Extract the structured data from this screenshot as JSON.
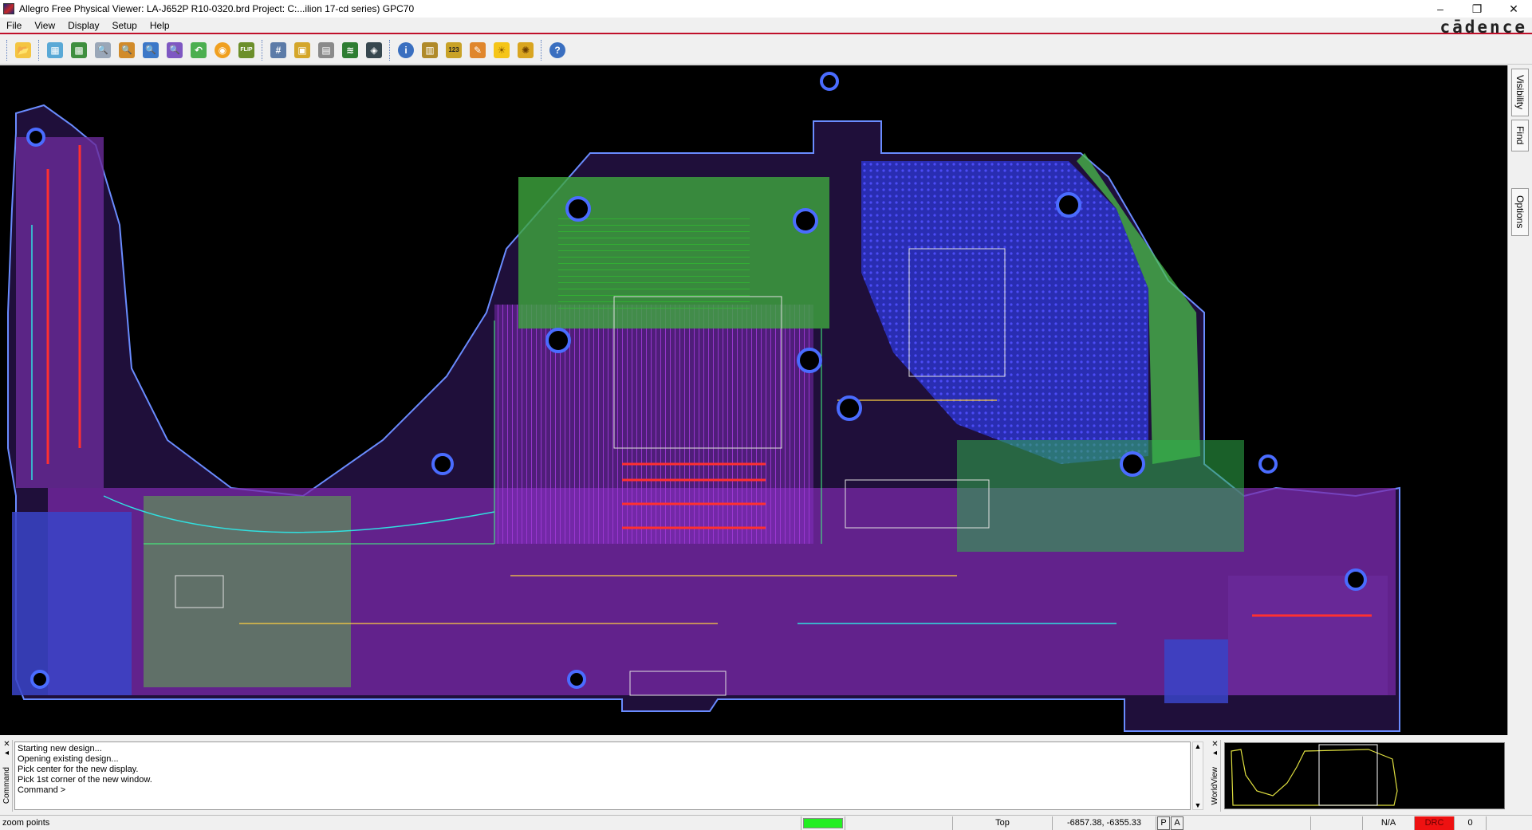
{
  "window": {
    "title": "Allegro Free Physical Viewer: LA-J652P R10-0320.brd  Project: C:...ilion 17-cd series) GPC70",
    "minimize": "–",
    "restore": "❐",
    "close": "✕",
    "brand": "cādence"
  },
  "menu": {
    "items": [
      {
        "label": "File"
      },
      {
        "label": "View"
      },
      {
        "label": "Display"
      },
      {
        "label": "Setup"
      },
      {
        "label": "Help"
      }
    ]
  },
  "toolbar": {
    "buttons": [
      {
        "icon": "open-folder-icon",
        "glyph": "📂"
      },
      {
        "icon": "zoom-fit-icon",
        "glyph": "▦"
      },
      {
        "icon": "zoom-world-icon",
        "glyph": "▩"
      },
      {
        "icon": "zoom-points-icon",
        "glyph": "🔍"
      },
      {
        "icon": "zoom-window-icon",
        "glyph": "🔍"
      },
      {
        "icon": "zoom-in-icon",
        "glyph": "🔍"
      },
      {
        "icon": "zoom-out-icon",
        "glyph": "🔍"
      },
      {
        "icon": "zoom-previous-icon",
        "glyph": "↶"
      },
      {
        "icon": "redraw-icon",
        "glyph": "◉"
      },
      {
        "icon": "flip-icon",
        "glyph": "FLIP"
      },
      {
        "icon": "grid-icon",
        "glyph": "#"
      },
      {
        "icon": "color-icon",
        "glyph": "▣"
      },
      {
        "icon": "layers-icon",
        "glyph": "▤"
      },
      {
        "icon": "stack-icon",
        "glyph": "≋"
      },
      {
        "icon": "3d-view-icon",
        "glyph": "◈"
      },
      {
        "icon": "info-icon",
        "glyph": "i"
      },
      {
        "icon": "report-icon",
        "glyph": "▥"
      },
      {
        "icon": "measure-icon",
        "glyph": "123"
      },
      {
        "icon": "highlight-icon",
        "glyph": "✎"
      },
      {
        "icon": "shadow-icon",
        "glyph": "☀"
      },
      {
        "icon": "dehighlight-icon",
        "glyph": "✺"
      },
      {
        "icon": "help-icon",
        "glyph": "?"
      }
    ]
  },
  "side_tabs": {
    "visibility": "Visibility",
    "find": "Find",
    "options": "Options"
  },
  "command": {
    "panel_label": "Command",
    "lines": [
      "Starting new design...",
      "Opening existing design...",
      "Pick center for the new display.",
      "Pick 1st corner of the new window.",
      "Command >"
    ]
  },
  "worldview": {
    "panel_label": "WorldView"
  },
  "status": {
    "message": "zoom points",
    "layer": "Top",
    "coords": "-6857.38, -6355.33",
    "p_flag": "P",
    "a_flag": "A",
    "na": "N/A",
    "drc": "DRC",
    "drc_count": "0"
  },
  "colors": {
    "accent": "#c0102a",
    "status_green": "#22ee22",
    "drc_red": "#ee1111"
  }
}
